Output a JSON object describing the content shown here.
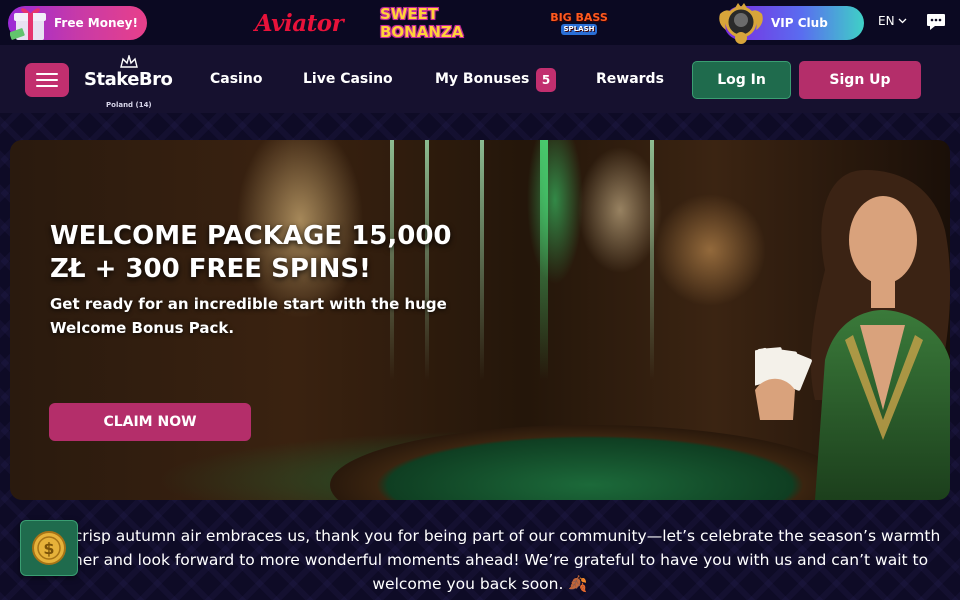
{
  "promo_bar": {
    "free_money_label": "Free Money!",
    "games": [
      {
        "name": "Aviator",
        "icon": "aviator-logo"
      },
      {
        "name": "SWEET BONANZA",
        "icon": "sweet-bonanza-logo"
      },
      {
        "name": "BIG BASS",
        "subtitle": "SPLASH",
        "icon": "big-bass-splash-logo"
      }
    ],
    "vip_label": "VIP Club",
    "language": "EN"
  },
  "nav": {
    "brand": "StakeBro",
    "brand_sub": "Poland (14)",
    "links": [
      "Casino",
      "Live Casino",
      "My Bonuses",
      "Rewards"
    ],
    "bonus_count": "5",
    "login_label": "Log In",
    "signup_label": "Sign Up"
  },
  "hero": {
    "title": "WELCOME PACKAGE 15,000 ZŁ + 300 FREE SPINS!",
    "subtitle": "Get ready for an incredible start with the huge Welcome Bonus Pack.",
    "cta_label": "CLAIM NOW"
  },
  "message": {
    "text": "As the crisp autumn air embraces us, thank you for being part of our community—let’s celebrate the season’s warmth together and look forward to more wonderful moments ahead! We’re grateful to have you with us and can’t wait to welcome you back soon. 🍂"
  },
  "colors": {
    "accent_pink": "#c22f6f",
    "login_green": "#1f6b4d",
    "background": "#0e0b26"
  }
}
